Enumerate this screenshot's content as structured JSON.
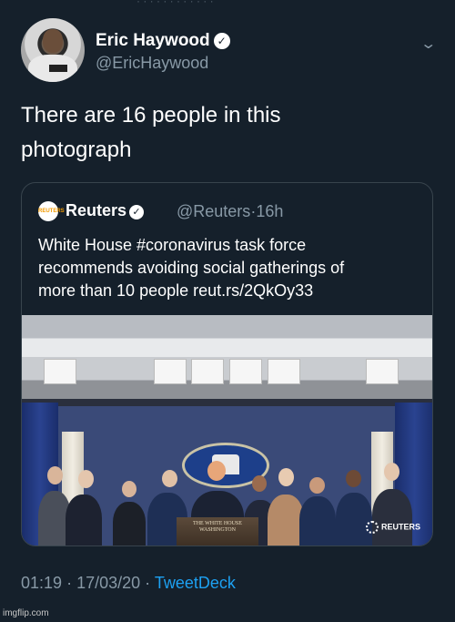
{
  "author": {
    "name": "Eric Haywood",
    "handle": "@EricHaywood",
    "verified_icon": "verified-badge-icon",
    "menu_icon": "chevron-down-icon"
  },
  "tweet": {
    "text_line1": "There are 16 people in this",
    "text_line2": "photograph"
  },
  "quoted": {
    "logo_text": "REUTERS",
    "name": "Reuters",
    "handle": "@Reuters",
    "separator": "·",
    "age": "16h",
    "text_line1": "White House #coronavirus task force",
    "text_line2": "recommends avoiding social gatherings of",
    "text_line3": "more than 10 people reut.rs/2QkOy33",
    "photo": {
      "podium_line1": "THE WHITE HOUSE",
      "podium_line2": "WASHINGTON",
      "watermark": "REUTERS"
    }
  },
  "meta": {
    "time": "01:19",
    "dot1": "·",
    "date": "17/03/20",
    "dot2": "·",
    "source": "TweetDeck"
  },
  "site_watermark": "imgflip.com",
  "colors": {
    "background": "#15202b",
    "secondary_text": "#8899a6",
    "link": "#1da1f2",
    "border": "#38444d"
  }
}
